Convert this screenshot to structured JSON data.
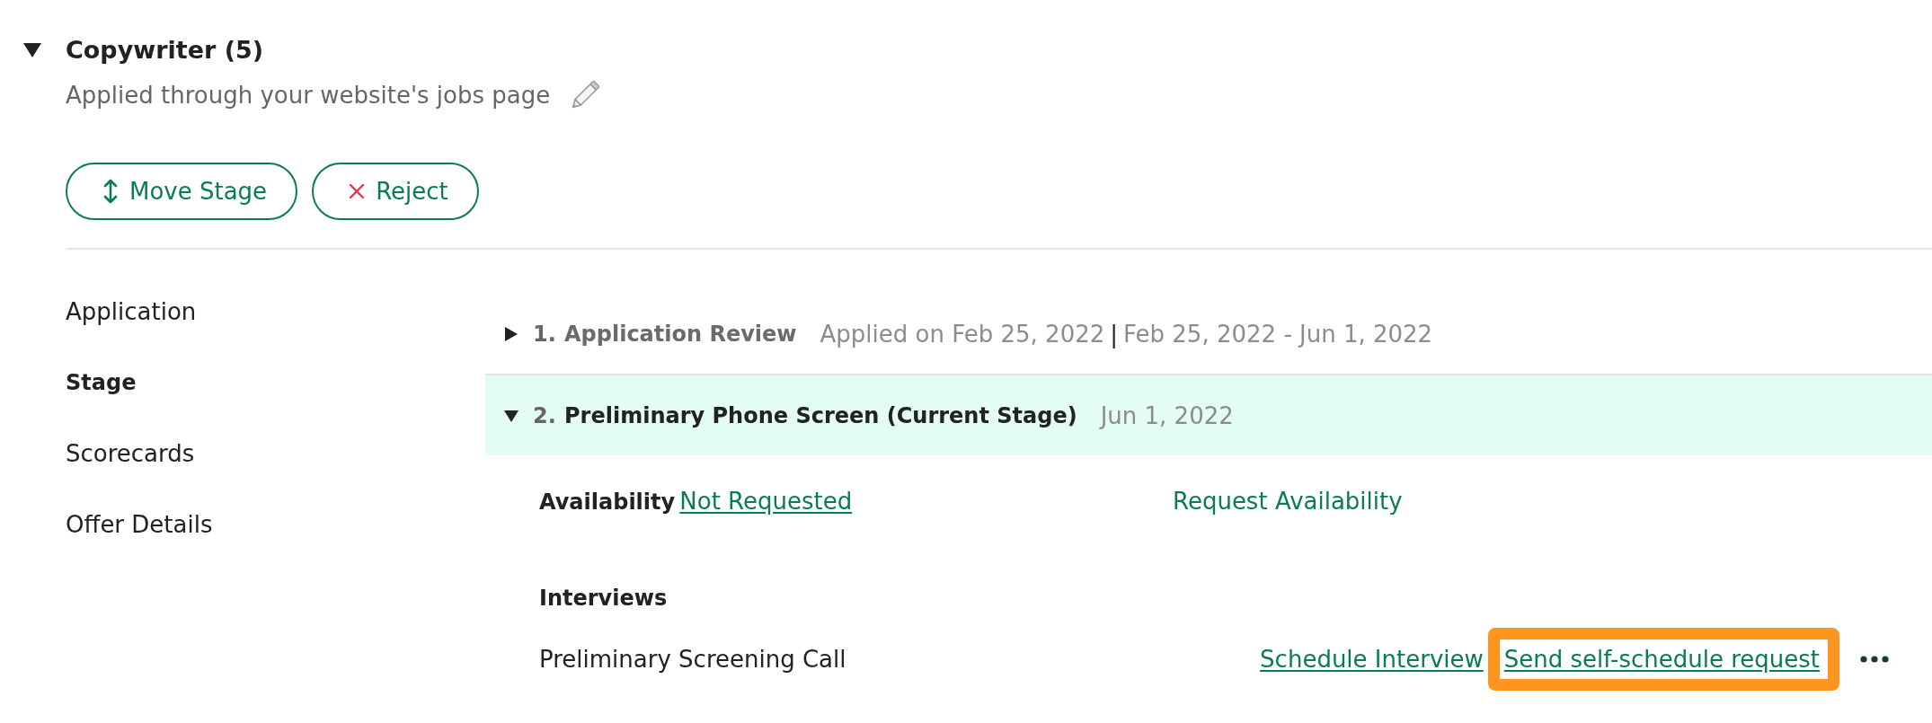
{
  "section": {
    "title": "Copywriter (5)",
    "expanded": true,
    "source": "Applied through your website's jobs page"
  },
  "actions": [
    {
      "label": "Move Stage",
      "kind": "move"
    },
    {
      "label": "Reject",
      "kind": "reject"
    }
  ],
  "sidebar": {
    "items": [
      {
        "label": "Application",
        "selected": false
      },
      {
        "label": "Stage",
        "selected": true
      },
      {
        "label": "Scorecards",
        "selected": false
      },
      {
        "label": "Offer Details",
        "selected": false
      }
    ]
  },
  "stages": [
    {
      "number": "1.",
      "name": "Application Review",
      "expanded": false,
      "current": false,
      "applied": "Applied on Feb 25, 2022",
      "separator": "|",
      "date_range": "Feb 25, 2022 - Jun 1, 2022"
    },
    {
      "number": "2.",
      "name": "Preliminary Phone Screen (Current Stage)",
      "expanded": true,
      "current": true,
      "date_range": "Jun 1, 2022",
      "details": {
        "availability": {
          "label": "Availability",
          "status": "Not Requested",
          "action": "Request Availability"
        },
        "interviews": {
          "heading": "Interviews",
          "items": [
            {
              "name": "Preliminary Screening Call",
              "actions": [
                {
                  "label": "Schedule Interview",
                  "highlighted": false
                },
                {
                  "label": "Send self-schedule request",
                  "highlighted": true
                }
              ]
            }
          ]
        }
      }
    }
  ]
}
